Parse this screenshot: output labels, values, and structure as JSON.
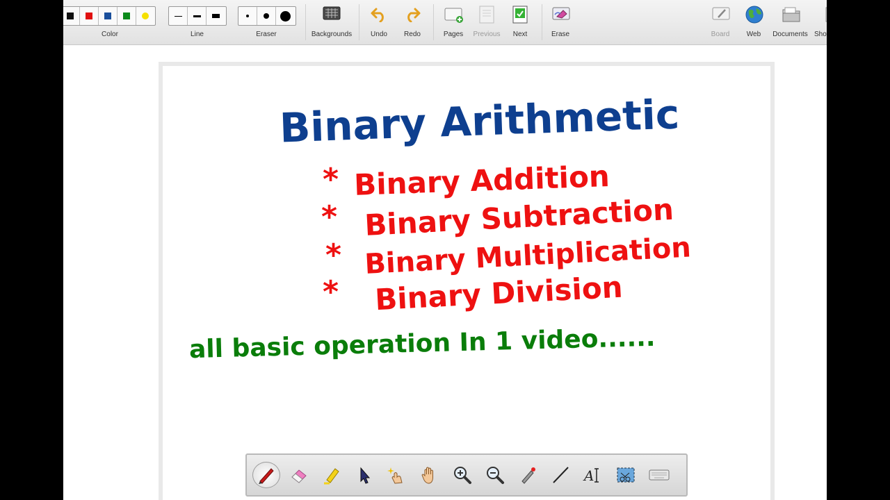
{
  "toolbar": {
    "color_label": "Color",
    "line_label": "Line",
    "eraser_label": "Eraser",
    "backgrounds_label": "Backgrounds",
    "undo_label": "Undo",
    "redo_label": "Redo",
    "pages_label": "Pages",
    "previous_label": "Previous",
    "next_label": "Next",
    "erase_label": "Erase",
    "board_label": "Board",
    "web_label": "Web",
    "documents_label": "Documents",
    "show_label": "Show",
    "colors": [
      "#111111",
      "#e01010",
      "#1a4f9c",
      "#0a8a1a",
      "#f5e000"
    ]
  },
  "board": {
    "title": "Binary Arithmetic",
    "title_color": "#0e3f8f",
    "items": [
      "Binary Addition",
      "Binary Subtraction",
      "Binary Multiplication",
      "Binary Division"
    ],
    "items_color": "#ee1111",
    "footer": "all basic operation In 1 video......",
    "footer_color": "#0a7d0a"
  },
  "bottom_tools": [
    "pen-icon",
    "eraser-icon",
    "highlighter-icon",
    "pointer-icon",
    "magic-pointer-icon",
    "hand-icon",
    "zoom-in-icon",
    "zoom-out-icon",
    "laser-icon",
    "line-icon",
    "text-icon",
    "screen-capture-icon",
    "keyboard-icon"
  ]
}
